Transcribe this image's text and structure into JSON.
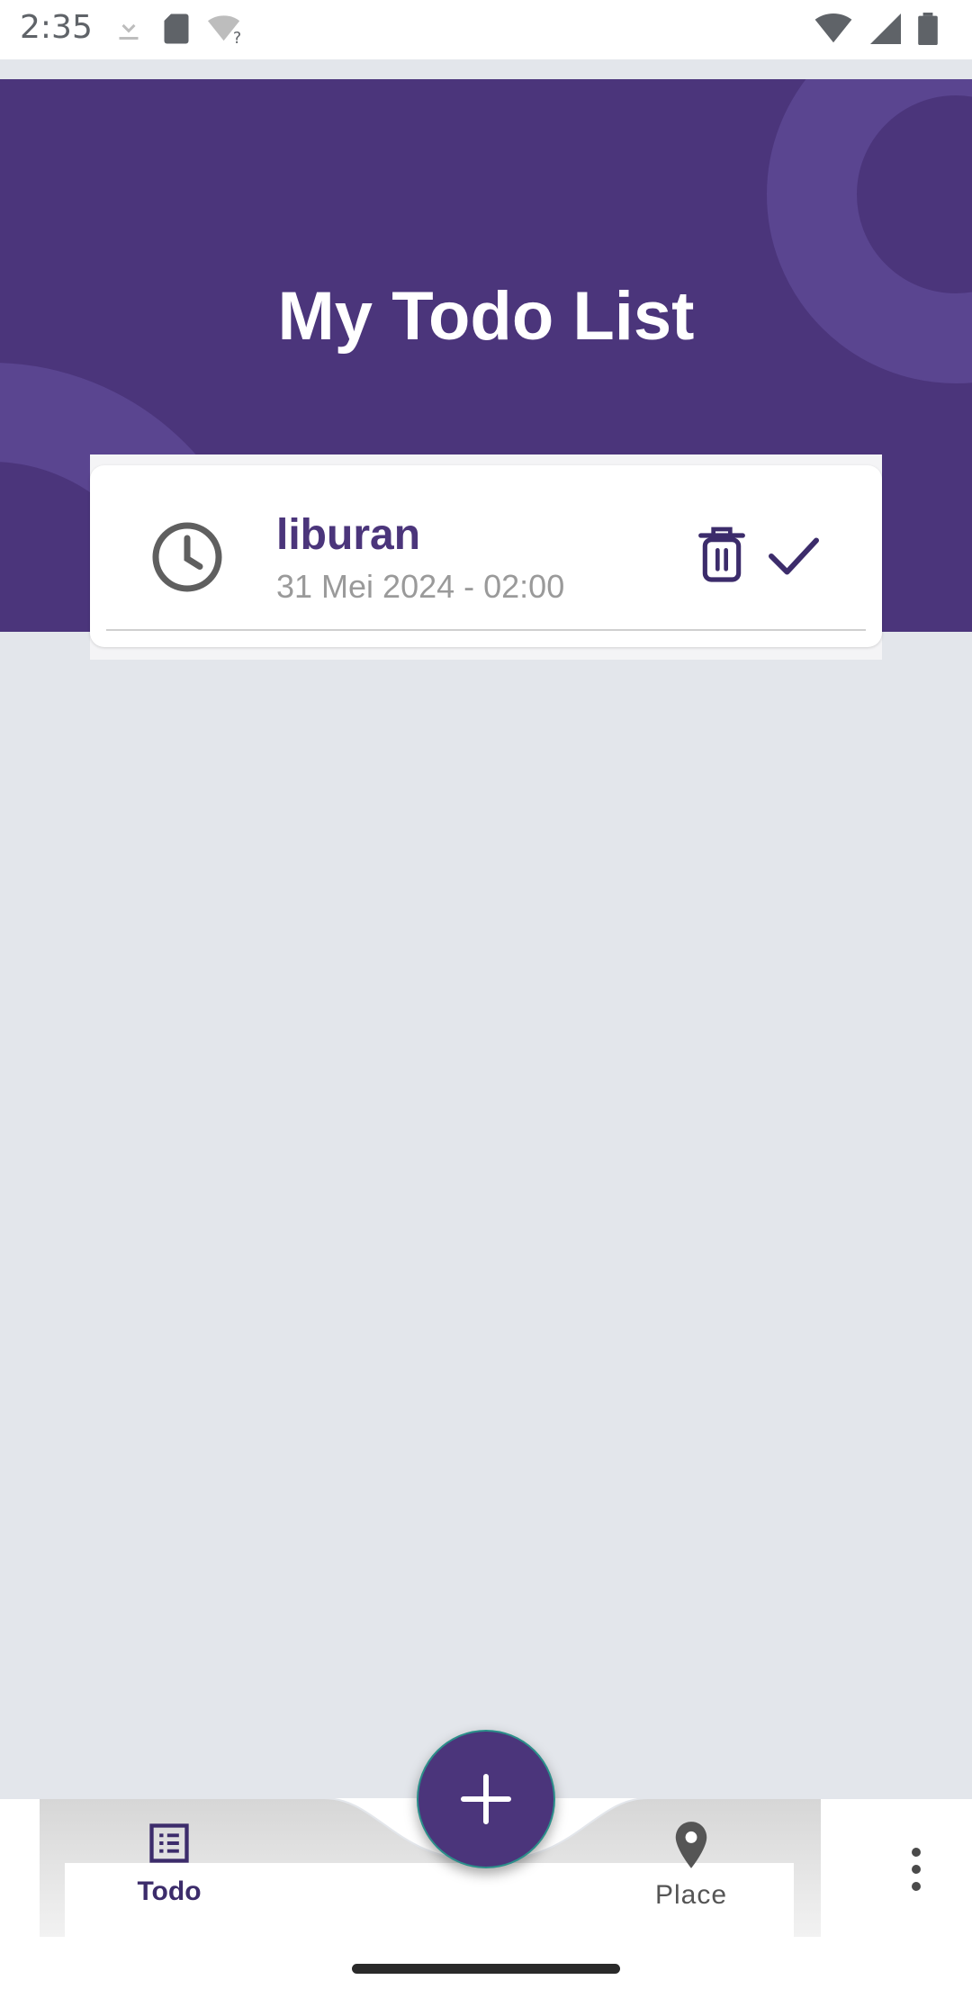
{
  "status_bar": {
    "time": "2:35",
    "left_icons": [
      "download-icon",
      "sd-card-icon",
      "wifi-question-icon"
    ],
    "right_icons": [
      "wifi-icon",
      "signal-icon",
      "battery-icon"
    ]
  },
  "header": {
    "title": "My Todo List",
    "background_color": "#4b357b"
  },
  "todos": [
    {
      "title": "liburan",
      "date": "31 Mei 2024 - 02:00",
      "icon": "clock-icon",
      "actions": [
        "trash-icon",
        "check-icon"
      ]
    }
  ],
  "fab": {
    "icon": "plus-icon",
    "color": "#4b357b"
  },
  "bottom_nav": {
    "items": [
      {
        "label": "Todo",
        "icon": "list-icon",
        "active": true
      },
      {
        "label": "Place",
        "icon": "location-pin-icon",
        "active": false
      }
    ],
    "more_icon": "more-vertical-icon"
  },
  "colors": {
    "accent": "#4b357b",
    "background": "#e3e6eb",
    "card": "#ffffff"
  }
}
